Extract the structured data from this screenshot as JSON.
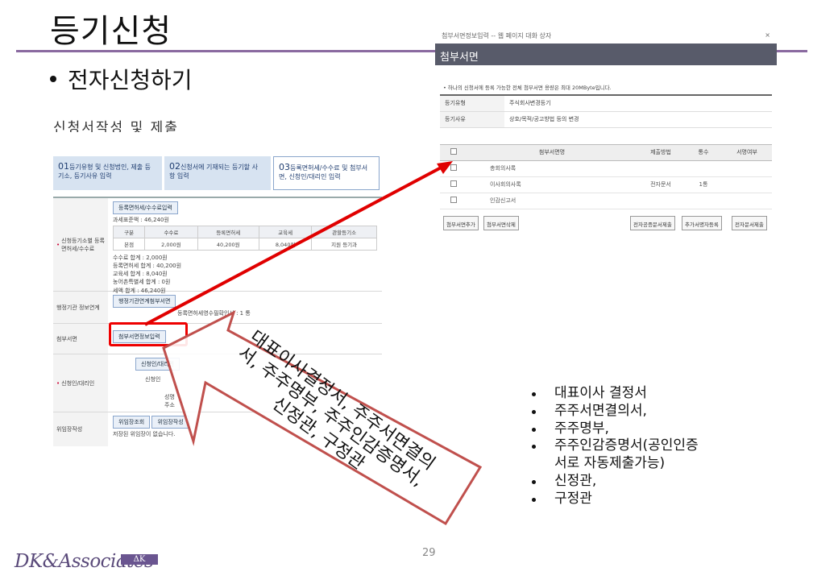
{
  "slide": {
    "title": "등기신청",
    "subtitle": "전자신청하기",
    "page_number": "29",
    "logo_text": "DK&Associates",
    "logo_mark": "ΔK"
  },
  "left_screenshot": {
    "heading": "신청서작성 및 제출",
    "steps": [
      {
        "num": "01",
        "label": "등기유형 및 신청법인, 제출 등기소, 등기사유 입력"
      },
      {
        "num": "02",
        "label": "신청서에 기재되는 등기할 사항 입력"
      },
      {
        "num": "03",
        "label": "등록면허세/수수료 및 첨부서면, 신청인/대리인 입력"
      }
    ],
    "fee_section": {
      "label": "신청등기소별 등록면허세/수수료",
      "button": "등록면허세/수수료입력",
      "total_line": "과세표준액 : 46,240원",
      "columns": [
        "구분",
        "수수료",
        "등록면허세",
        "교육세",
        "관할등기소"
      ],
      "row": [
        "본점",
        "2,000원",
        "40,200원",
        "8,040원",
        "지원 등기과"
      ],
      "summary": [
        "수수료 합계 : 2,000원",
        "등록면허세 합계 : 40,200원",
        "교육세 합계 : 8,040원",
        "농어촌특별세 합계 : 0원",
        "세액 합계 : 46,240원"
      ]
    },
    "admin_section": {
      "label": "행정기관 정보연계",
      "button": "행정기관연계첨부서면",
      "note": "등록면허세영수필확인서 : 1 통"
    },
    "attach_section": {
      "label": "첨부서면",
      "button": "첨부서면정보입력"
    },
    "applicant_section": {
      "label": "신청인/대리인",
      "button": "신청인/대리인",
      "fields": [
        "신청인",
        "성명",
        "주소"
      ]
    },
    "proxy_section": {
      "label": "위임장작성",
      "buttons": [
        "위임장조회",
        "위임장작성"
      ],
      "note": "저장된 위임장이 없습니다."
    }
  },
  "dialog": {
    "window_title": "첨부서면정보입력 -- 웹 페이지 대화 상자",
    "close_symbol": "×",
    "header": "첨부서면",
    "notice": "하나의 신청서에 등록 가능한 전체 첨부서면 용량은 최대 20MByte입니다.",
    "info": [
      {
        "key": "등기유형",
        "value": "주식회사변경등기"
      },
      {
        "key": "등기사유",
        "value": "상호/목적/공고방법 등의 변경"
      }
    ],
    "columns": [
      "첨부서면명",
      "제출방법",
      "통수",
      "서명여부"
    ],
    "rows": [
      {
        "name": "총회의사록",
        "method": "",
        "count": "",
        "signed": ""
      },
      {
        "name": "이사회의사록",
        "method": "전자문서",
        "count": "1통",
        "signed": ""
      },
      {
        "name": "인감신고서",
        "method": "",
        "count": "",
        "signed": ""
      }
    ],
    "buttons": {
      "add": "첨부서면추가",
      "delete": "첨부서면삭제",
      "e_public": "전자공증문서제출",
      "add_signer": "추가서명자등록",
      "e_doc": "전자문서제출"
    }
  },
  "callout": {
    "lines": [
      "대표이사결정서, 주주서면결의",
      "서, 주주명부, 주주인감증명서,",
      "신정관, 구정관"
    ]
  },
  "bullets": [
    "대표이사 결정서",
    "주주서면결의서,",
    "주주명부,",
    "주주인감증명서(공인인증",
    "서로 자동제출가능)",
    "신정관,",
    "구정관"
  ],
  "colors": {
    "accent_rule": "#8a6aa0",
    "dialog_header": "#585b6a",
    "highlight_red": "#e00000",
    "callout_border": "#c0504d"
  }
}
